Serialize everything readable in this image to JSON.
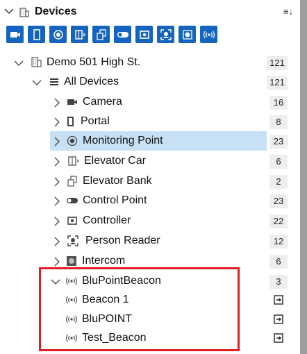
{
  "header": {
    "title": "Devices",
    "menu_icon": "list-sort-icon"
  },
  "toolbar": {
    "accent": "#1565c0",
    "buttons": [
      "camera-filter-icon",
      "portal-filter-icon",
      "monitoring-point-filter-icon",
      "elevator-car-filter-icon",
      "elevator-bank-filter-icon",
      "control-point-filter-icon",
      "controller-filter-icon",
      "person-reader-filter-icon",
      "intercom-filter-icon",
      "beacon-filter-icon"
    ]
  },
  "tree": {
    "site": {
      "label": "Demo 501 High St.",
      "count": "121"
    },
    "all": {
      "label": "All Devices",
      "count": "121"
    },
    "items": [
      {
        "label": "Camera",
        "count": "16"
      },
      {
        "label": "Portal",
        "count": "8"
      },
      {
        "label": "Monitoring Point",
        "count": "23"
      },
      {
        "label": "Elevator Car",
        "count": "6"
      },
      {
        "label": "Elevator Bank",
        "count": "2"
      },
      {
        "label": "Control Point",
        "count": "23"
      },
      {
        "label": "Controller",
        "count": "22"
      },
      {
        "label": "Person Reader",
        "count": "12"
      },
      {
        "label": "Intercom",
        "count": "6"
      },
      {
        "label": "BluPointBeacon",
        "count": "3"
      }
    ],
    "beacons": [
      {
        "label": "Beacon 1"
      },
      {
        "label": "BluPOINT"
      },
      {
        "label": "Test_Beacon"
      }
    ]
  },
  "colors": {
    "selected_row": "#c7e0f4",
    "highlight_box": "#e01c24"
  }
}
